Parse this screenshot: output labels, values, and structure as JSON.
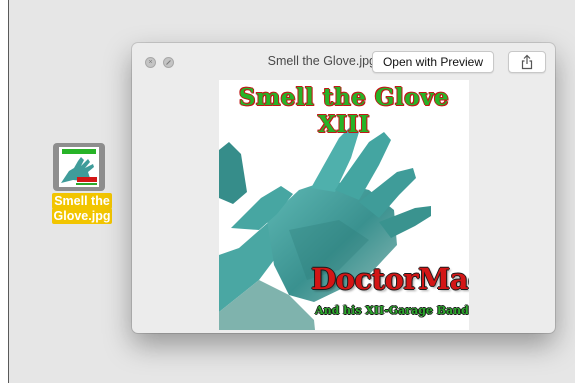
{
  "desktop": {
    "file": {
      "name": "Smell the Glove.jpg",
      "label_line1": "Smell the",
      "label_line2": "Glove.jpg"
    }
  },
  "quicklook": {
    "title": "Smell the Glove.jpg",
    "open_button_label": "Open with Preview",
    "close_icon": "close-icon",
    "fullscreen_icon": "fullscreen-icon",
    "share_icon": "share-icon"
  },
  "image": {
    "title_text": "Smell the Glove XIII",
    "artist_text": "DoctorMac",
    "subtitle_text": "And his XII-Garage Band"
  },
  "colors": {
    "desktop_bg": "#e6e6e6",
    "selection_label_bg": "#f2c500",
    "window_bg": "#ececec",
    "glove_color": "#3f9c9a",
    "title_green": "#27b327",
    "artist_red": "#d31616"
  }
}
